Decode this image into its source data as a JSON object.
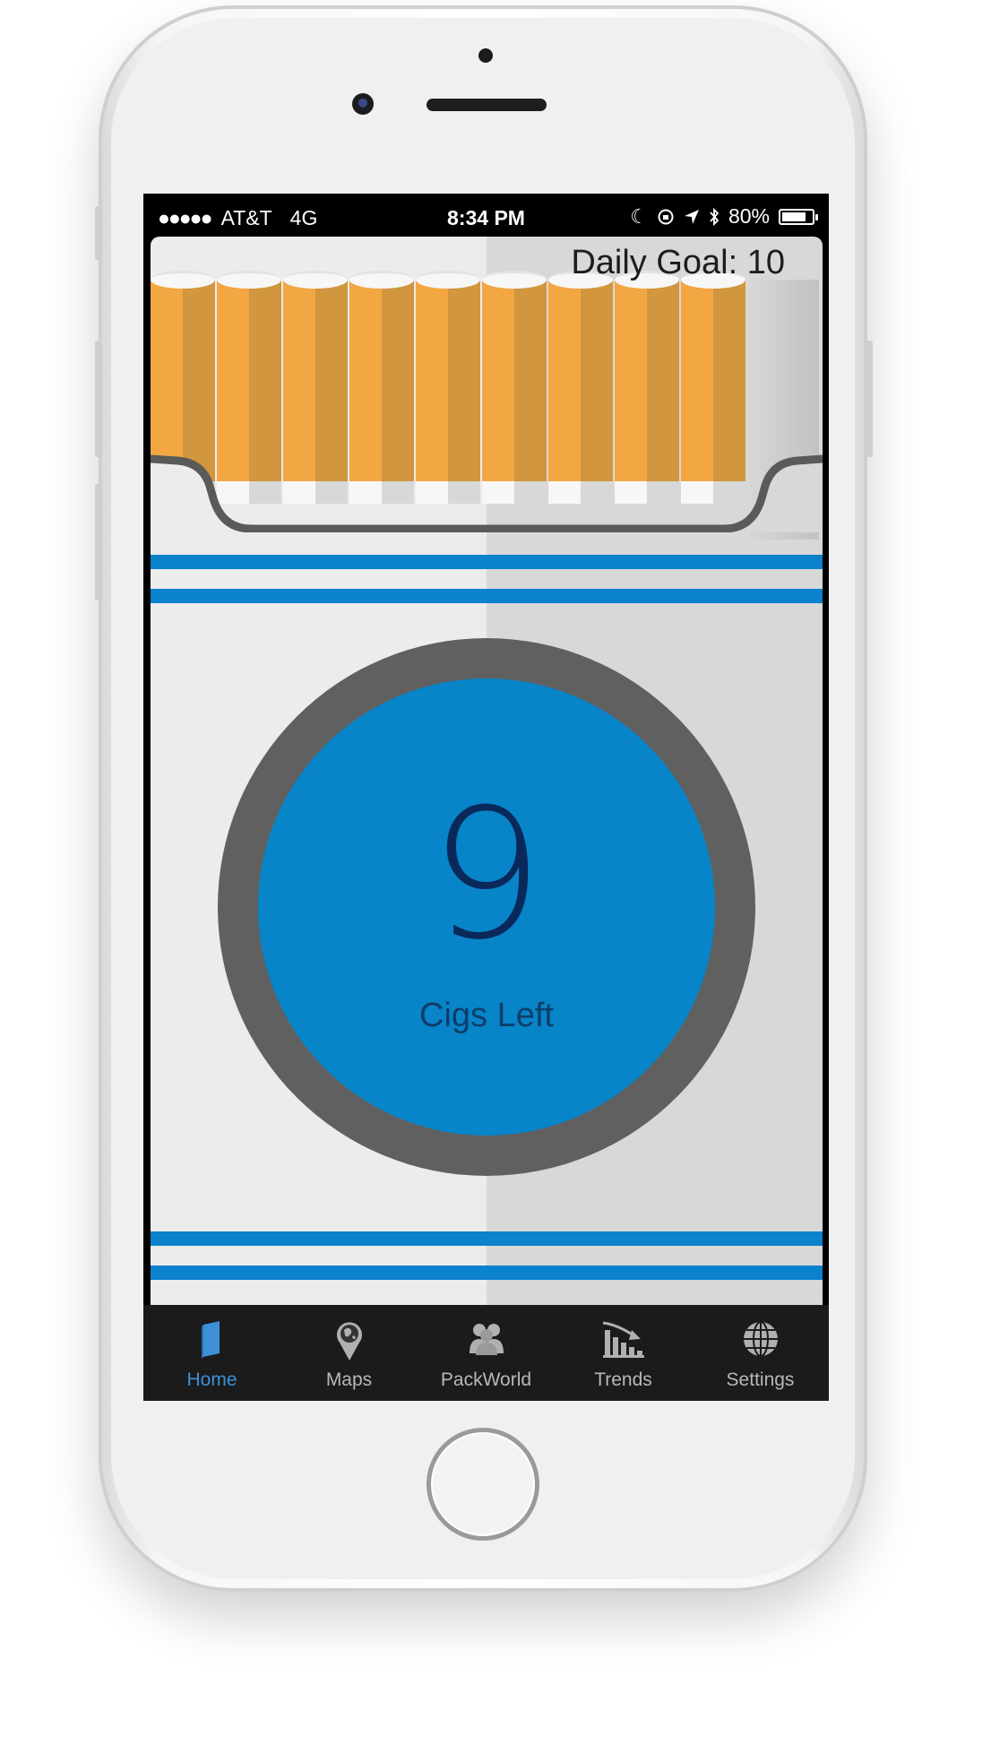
{
  "status_bar": {
    "signal": "●●●●●",
    "carrier": "AT&T",
    "network": "4G",
    "time": "8:34 PM",
    "battery": "80%",
    "battery_level": 0.8
  },
  "pack": {
    "daily_goal": "Daily Goal: 10",
    "cigarettes_remaining": 9,
    "cigarette_slots": 10
  },
  "counter": {
    "count": "9",
    "label": "Cigs Left"
  },
  "colors": {
    "accent_blue": "#0884c8",
    "ring_gray": "#606060",
    "cigarette_orange": "#f2a743",
    "tab_active": "#3d8fd8"
  },
  "tab_bar": {
    "tabs": [
      {
        "label": "Home",
        "icon": "book-icon",
        "active": true
      },
      {
        "label": "Maps",
        "icon": "map-pin-globe-icon",
        "active": false
      },
      {
        "label": "PackWorld",
        "icon": "people-icon",
        "active": false
      },
      {
        "label": "Trends",
        "icon": "trend-chart-icon",
        "active": false
      },
      {
        "label": "Settings",
        "icon": "globe-icon",
        "active": false
      }
    ]
  }
}
